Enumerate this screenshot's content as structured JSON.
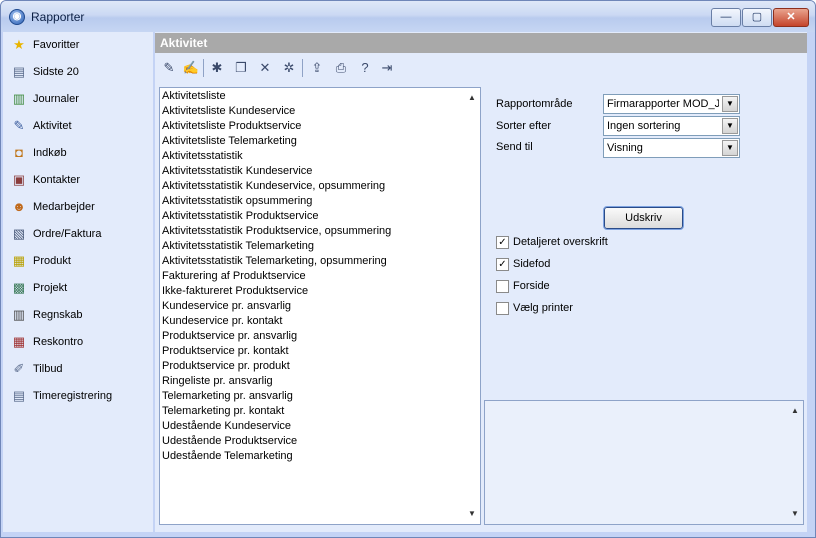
{
  "window": {
    "title": "Rapporter",
    "app_icon": "app-logo-icon",
    "controls": {
      "minimize": "—",
      "maximize": "▢",
      "close": "✕"
    }
  },
  "sidebar": {
    "items": [
      {
        "label": "Favoritter",
        "icon": "star-icon",
        "glyph": "★",
        "color": "#e8b400"
      },
      {
        "label": "Sidste 20",
        "icon": "recent-icon",
        "glyph": "▤",
        "color": "#5a6b8c"
      },
      {
        "label": "Journaler",
        "icon": "journal-icon",
        "glyph": "▥",
        "color": "#3d8a3d"
      },
      {
        "label": "Aktivitet",
        "icon": "activity-icon",
        "glyph": "✎",
        "color": "#3b5d9e"
      },
      {
        "label": "Indkøb",
        "icon": "purchase-icon",
        "glyph": "◘",
        "color": "#c0771c"
      },
      {
        "label": "Kontakter",
        "icon": "contacts-icon",
        "glyph": "▣",
        "color": "#8a3d3d"
      },
      {
        "label": "Medarbejder",
        "icon": "employee-icon",
        "glyph": "☻",
        "color": "#c06a1c"
      },
      {
        "label": "Ordre/Faktura",
        "icon": "order-icon",
        "glyph": "▧",
        "color": "#4a5a7a"
      },
      {
        "label": "Produkt",
        "icon": "product-icon",
        "glyph": "▦",
        "color": "#b8a000"
      },
      {
        "label": "Projekt",
        "icon": "project-icon",
        "glyph": "▩",
        "color": "#3b7a5a"
      },
      {
        "label": "Regnskab",
        "icon": "accounting-icon",
        "glyph": "▥",
        "color": "#4a4a4a"
      },
      {
        "label": "Reskontro",
        "icon": "ledger-icon",
        "glyph": "▦",
        "color": "#9e2f2f"
      },
      {
        "label": "Tilbud",
        "icon": "offer-icon",
        "glyph": "✐",
        "color": "#5a6b8c"
      },
      {
        "label": "Timeregistrering",
        "icon": "timesheet-icon",
        "glyph": "▤",
        "color": "#5a6b8c"
      }
    ]
  },
  "main": {
    "header": "Aktivitet",
    "toolbar": [
      {
        "icon": "edit-icon",
        "glyph": "✎"
      },
      {
        "icon": "edit-properties-icon",
        "glyph": "✍"
      },
      {
        "icon": "new-icon",
        "glyph": "✱"
      },
      {
        "icon": "copy-icon",
        "glyph": "❐"
      },
      {
        "icon": "delete-icon",
        "glyph": "✕"
      },
      {
        "icon": "wizard-icon",
        "glyph": "✲"
      },
      {
        "icon": "export-icon",
        "glyph": "⇪"
      },
      {
        "icon": "print-icon",
        "glyph": "⎙"
      },
      {
        "icon": "help-icon",
        "glyph": "?"
      },
      {
        "icon": "exit-icon",
        "glyph": "⇥"
      }
    ],
    "reports": [
      "Aktivitetsliste",
      "Aktivitetsliste Kundeservice",
      "Aktivitetsliste Produktservice",
      "Aktivitetsliste Telemarketing",
      "Aktivitetsstatistik",
      "Aktivitetsstatistik Kundeservice",
      "Aktivitetsstatistik Kundeservice, opsummering",
      "Aktivitetsstatistik opsummering",
      "Aktivitetsstatistik Produktservice",
      "Aktivitetsstatistik Produktservice, opsummering",
      "Aktivitetsstatistik Telemarketing",
      "Aktivitetsstatistik Telemarketing, opsummering",
      "Fakturering af Produktservice",
      "Ikke-faktureret Produktservice",
      "Kundeservice pr. ansvarlig",
      "Kundeservice pr. kontakt",
      "Produktservice pr. ansvarlig",
      "Produktservice pr. kontakt",
      "Produktservice pr. produkt",
      "Ringeliste pr. ansvarlig",
      "Telemarketing pr. ansvarlig",
      "Telemarketing pr. kontakt",
      "Udestående Kundeservice",
      "Udestående Produktservice",
      "Udestående Telemarketing"
    ],
    "settings": {
      "area_label": "Rapportområde",
      "area_value": "Firmarapporter MOD_JC",
      "sort_label": "Sorter efter",
      "sort_value": "Ingen sortering",
      "send_label": "Send til",
      "send_value": "Visning",
      "print_button": "Udskriv",
      "checkboxes": [
        {
          "label": "Detaljeret overskrift",
          "checked": true
        },
        {
          "label": "Sidefod",
          "checked": true
        },
        {
          "label": "Forside",
          "checked": false
        },
        {
          "label": "Vælg printer",
          "checked": false
        }
      ]
    }
  }
}
